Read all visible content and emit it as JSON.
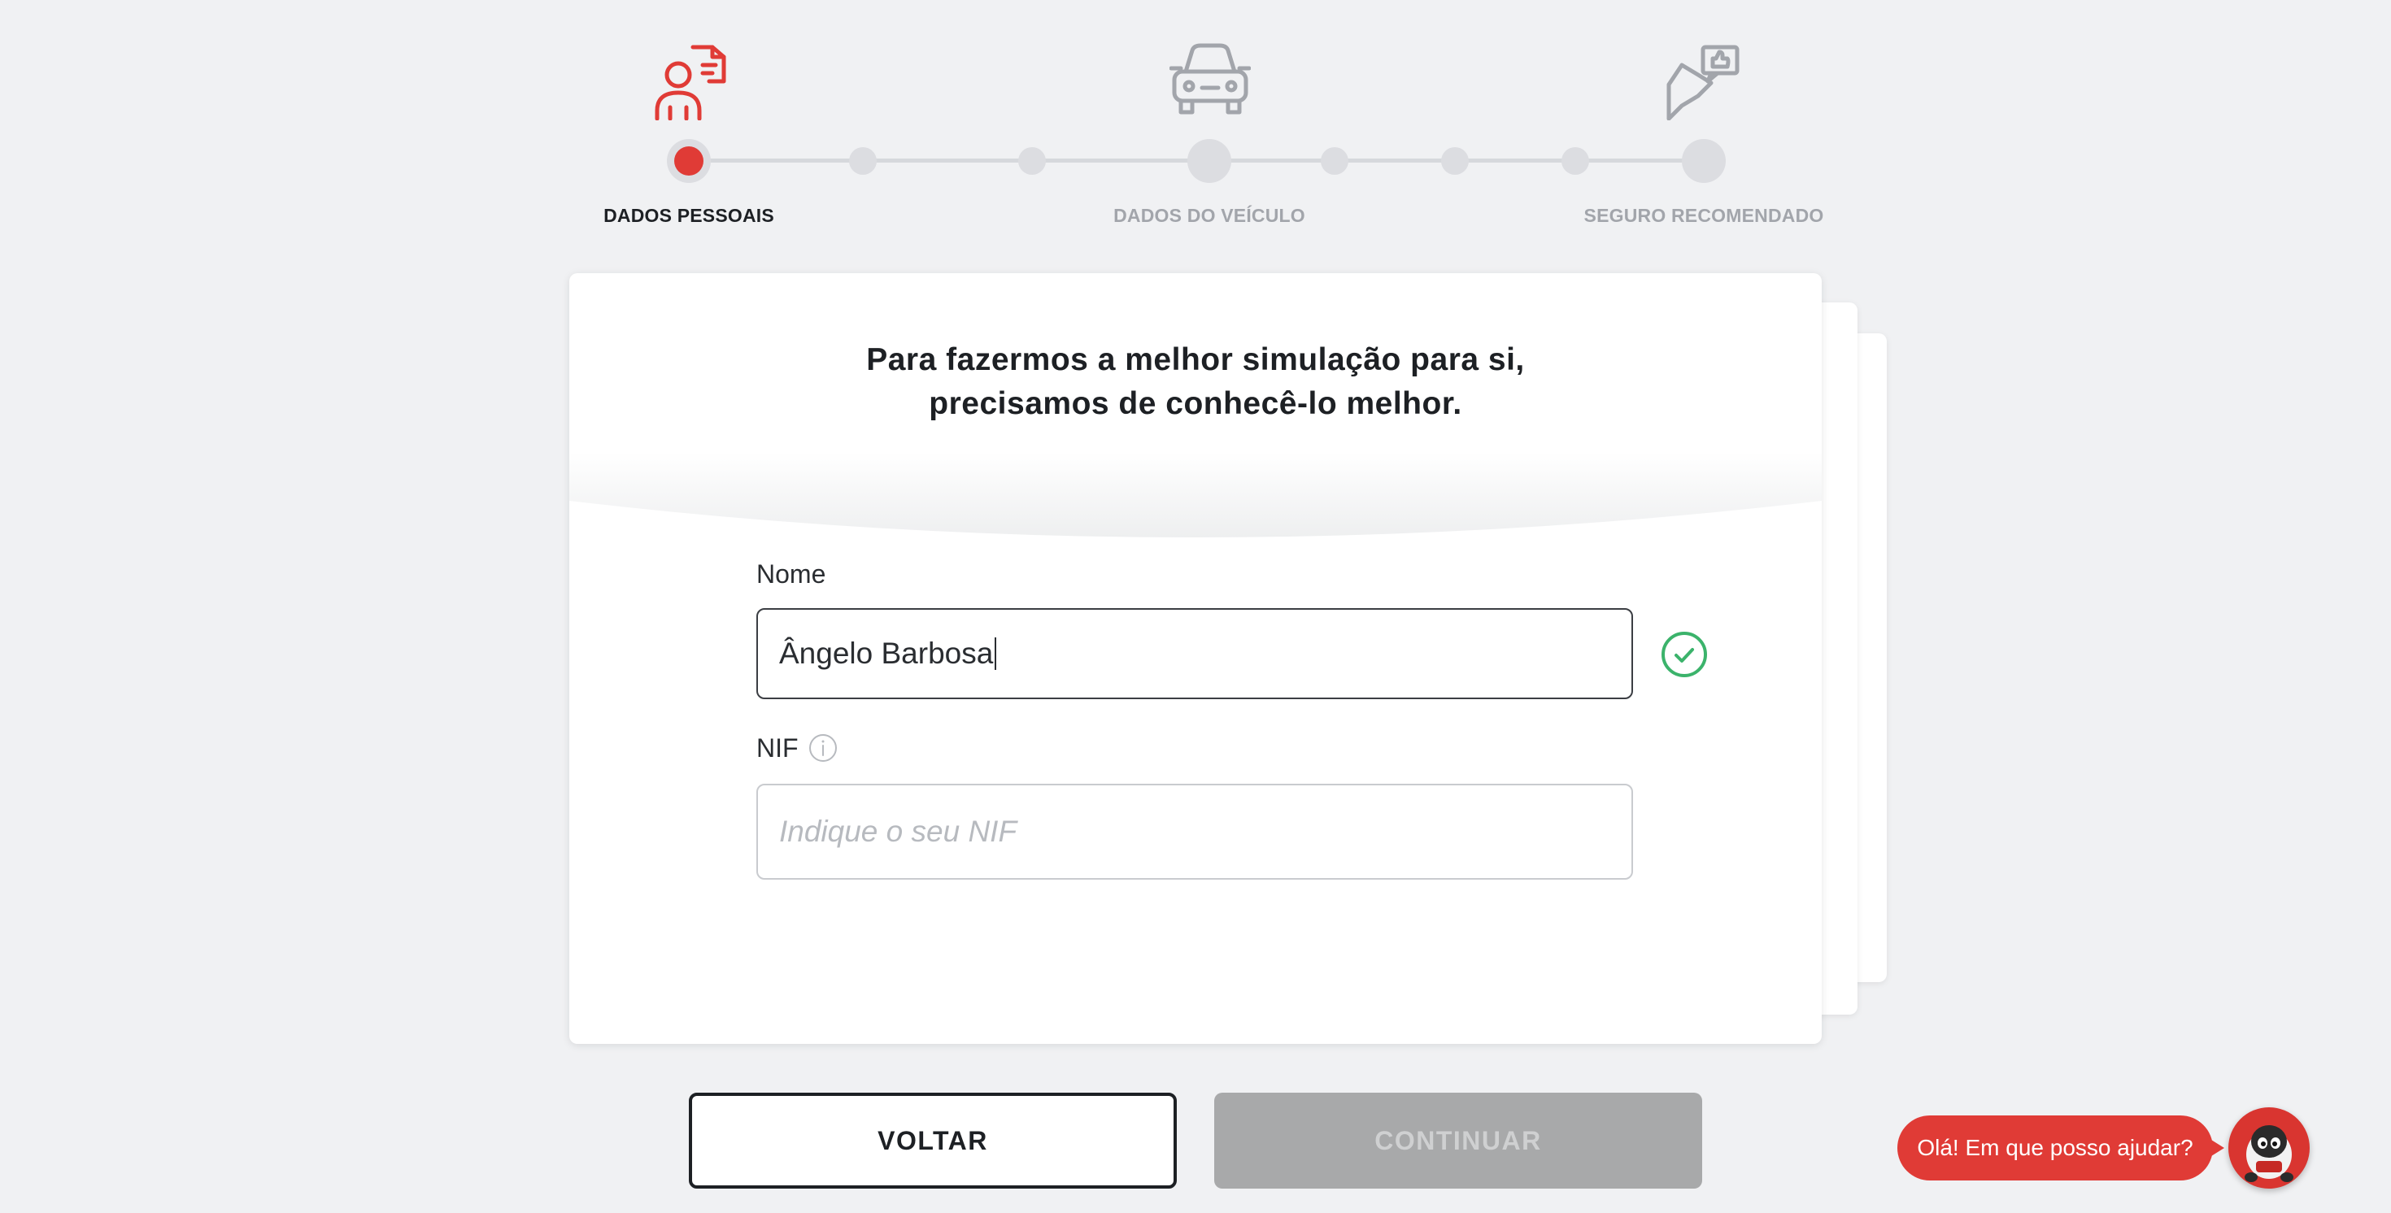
{
  "stepper": {
    "steps": [
      {
        "label": "DADOS PESSOAIS",
        "icon": "person-document-icon",
        "state": "current"
      },
      {
        "label": "DADOS DO VEÍCULO",
        "icon": "car-icon",
        "state": "future"
      },
      {
        "label": "SEGURO RECOMENDADO",
        "icon": "thumbs-up-chat-icon",
        "state": "future"
      }
    ],
    "colors": {
      "active": "#e03b36",
      "inactive": "#dcdde1",
      "icon_inactive": "#a2a5ab"
    }
  },
  "card": {
    "title_line1": "Para fazermos a melhor simulação para si,",
    "title_line2": "precisamos de conhecê-lo melhor."
  },
  "form": {
    "name_label": "Nome",
    "name_value": "Ângelo Barbosa",
    "name_valid": true,
    "nif_label": "NIF",
    "nif_placeholder": "Indique o seu NIF",
    "nif_value": ""
  },
  "buttons": {
    "back_label": "VOLTAR",
    "continue_label": "CONTINUAR"
  },
  "chat": {
    "greeting": "Olá! Em que posso ajudar?"
  }
}
